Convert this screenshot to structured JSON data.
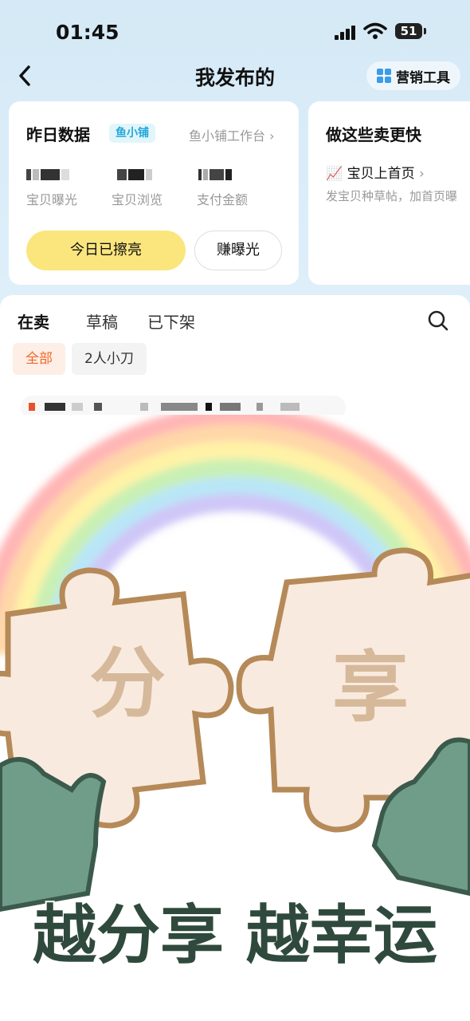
{
  "status": {
    "time": "01:45",
    "battery": "51"
  },
  "nav": {
    "title": "我发布的",
    "marketing_label": "营销工具"
  },
  "data_card": {
    "title": "昨日数据",
    "badge": "鱼小铺",
    "workbench": "鱼小铺工作台",
    "stats": [
      {
        "label": "宝贝曝光"
      },
      {
        "label": "宝贝浏览"
      },
      {
        "label": "支付金额"
      }
    ],
    "btn_polished": "今日已擦亮",
    "btn_earn": "赚曝光"
  },
  "promo_card": {
    "title": "做这些卖更快",
    "item": "宝贝上首页",
    "sub": "发宝贝种草帖，加首页曝"
  },
  "tabs": [
    "在卖",
    "草稿",
    "已下架"
  ],
  "filters": [
    "全部",
    "2人小刀"
  ],
  "share_image": {
    "text_puzzle_left": "分",
    "text_puzzle_right": "享",
    "slogan": "越分享 越幸运"
  },
  "colors": {
    "accent_yellow": "#fbe67e",
    "filter_active": "#ef6a2a",
    "badge": "#21a7d9",
    "slogan": "#2f4a3c"
  }
}
